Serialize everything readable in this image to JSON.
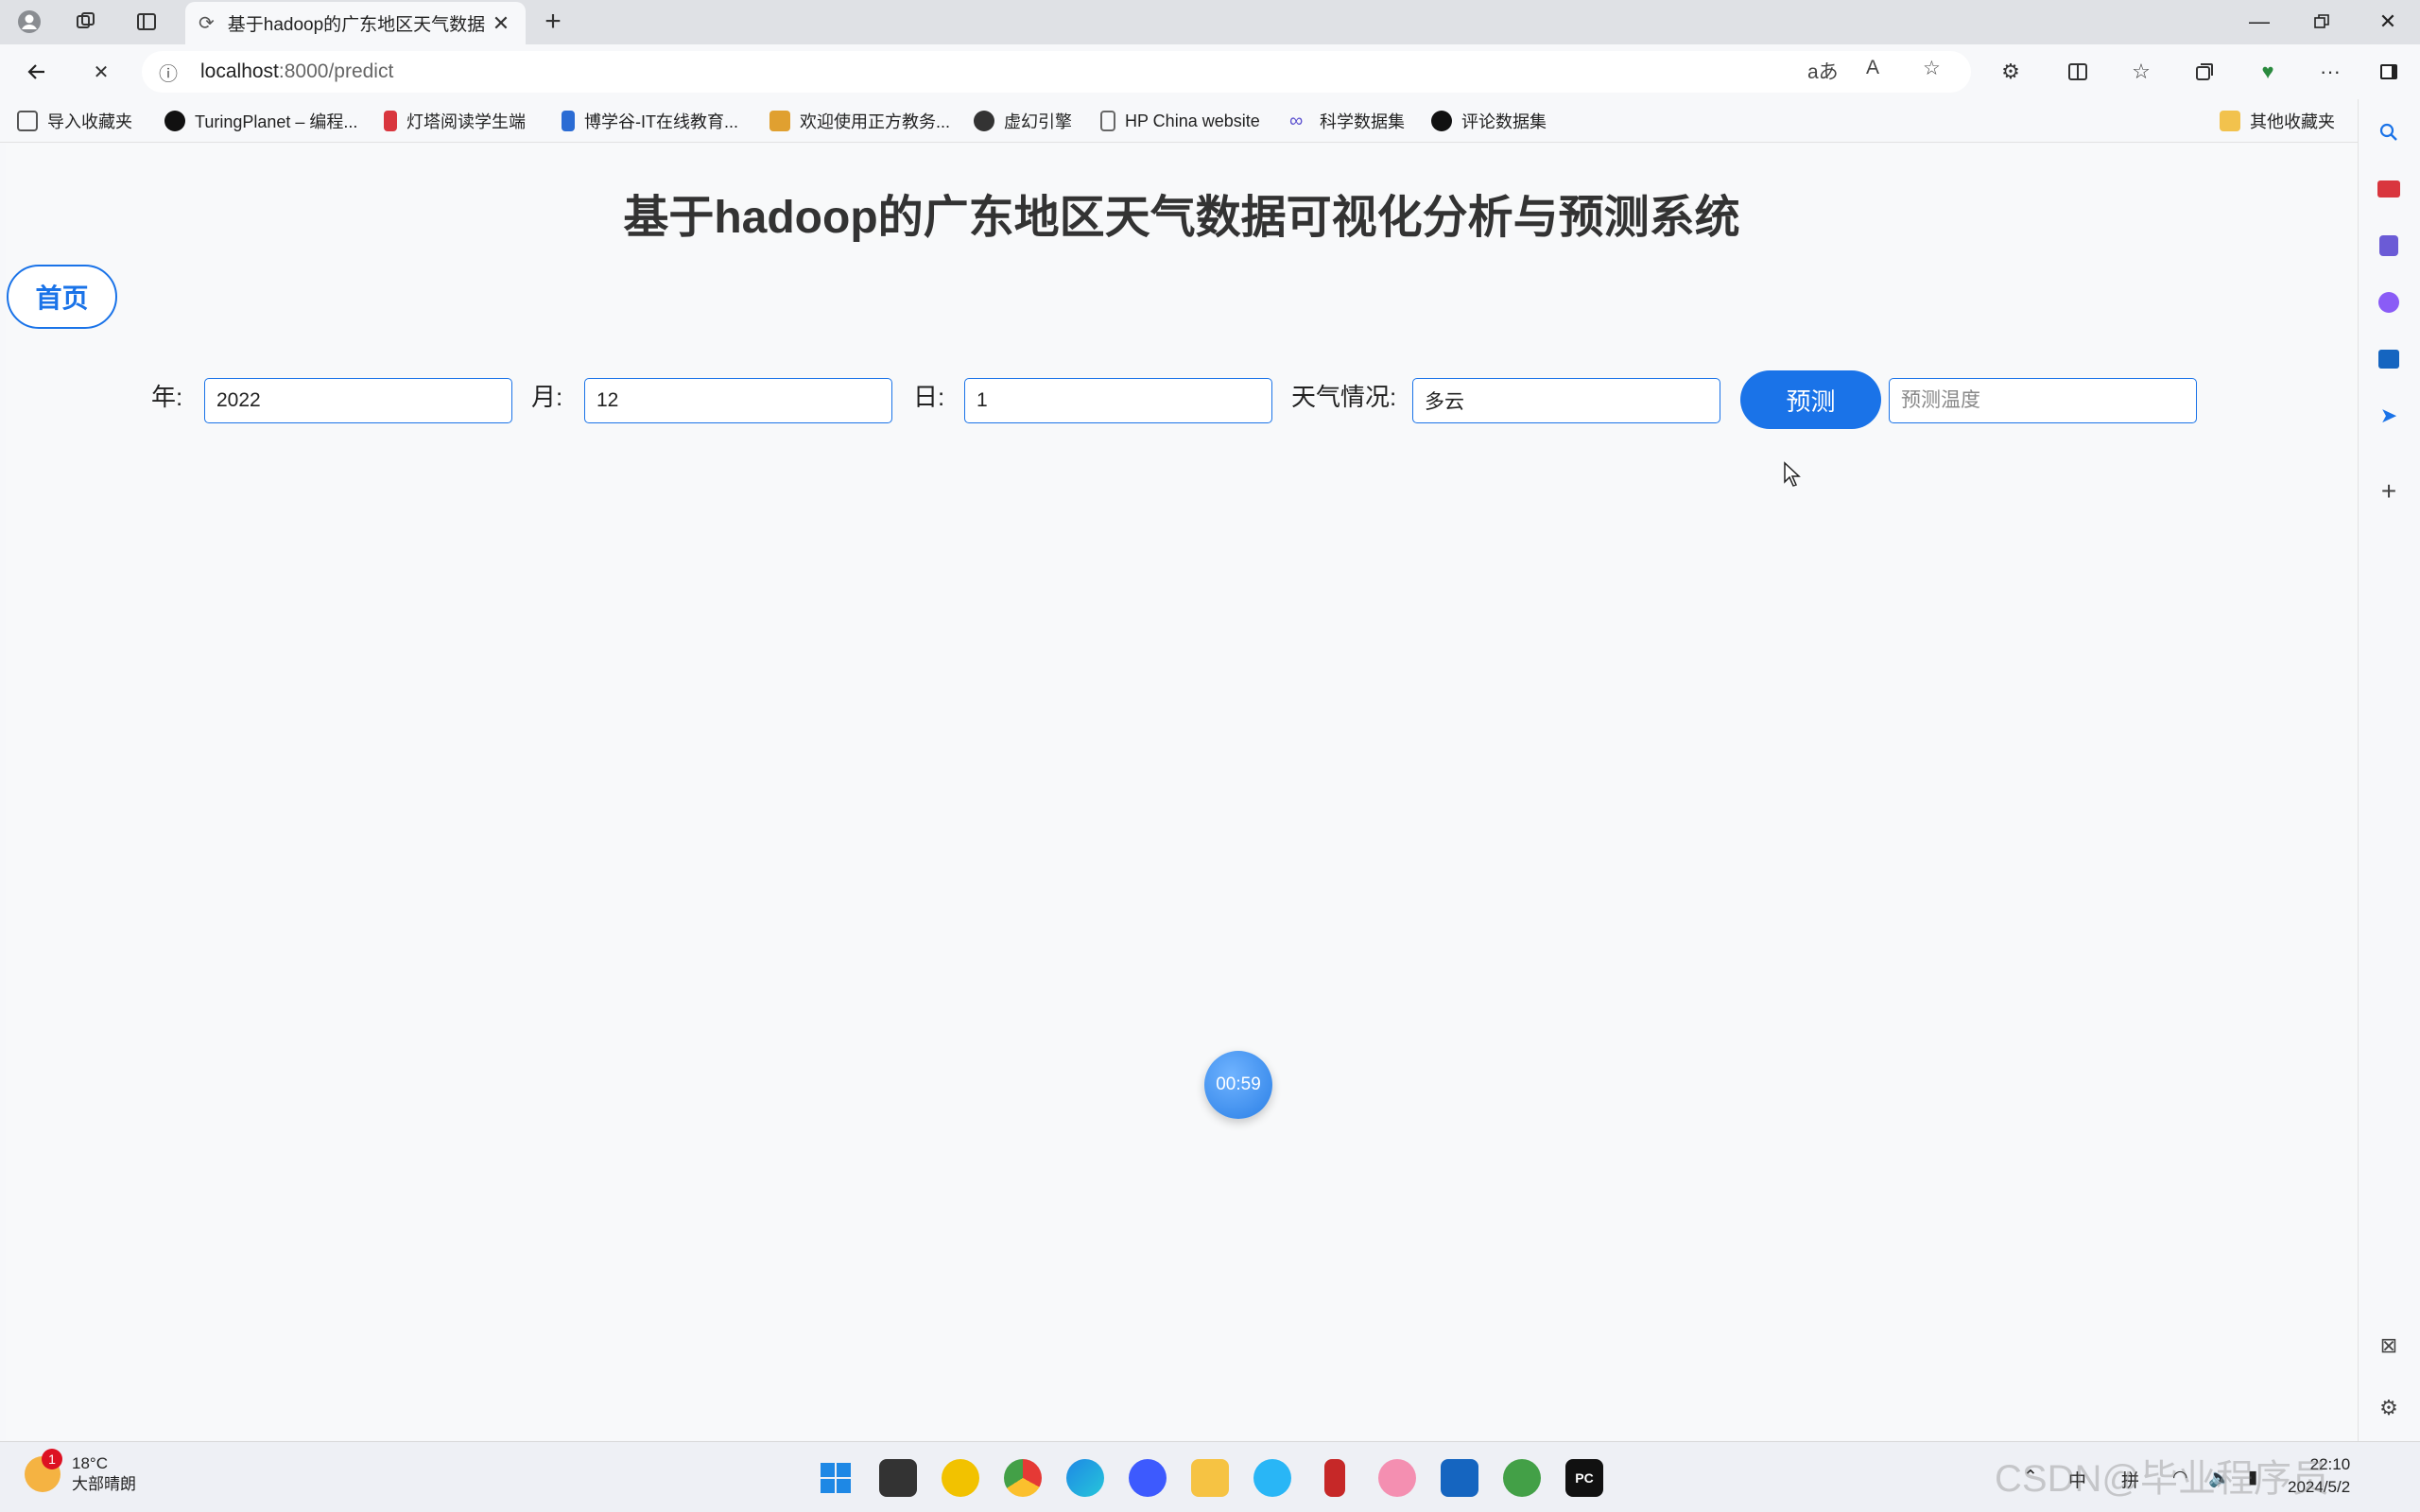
{
  "browser": {
    "tab_title": "基于hadoop的广东地区天气数据",
    "url_host": "localhost",
    "url_path": ":8000/predict"
  },
  "bookmarks": [
    {
      "label": "导入收藏夹",
      "color": "#555555"
    },
    {
      "label": "TuringPlanet – 编程...",
      "color": "#111111"
    },
    {
      "label": "灯塔阅读学生端",
      "color": "#d9363e"
    },
    {
      "label": "博学谷-IT在线教育...",
      "color": "#2b6cd4"
    },
    {
      "label": "欢迎使用正方教务...",
      "color": "#e0a030"
    },
    {
      "label": "虚幻引擎",
      "color": "#333333"
    },
    {
      "label": "HP China website",
      "color": "#666666"
    },
    {
      "label": "科学数据集",
      "color": "#5a4fcf"
    },
    {
      "label": "评论数据集",
      "color": "#111111"
    }
  ],
  "bookmarks_other": "其他收藏夹",
  "page": {
    "title": "基于hadoop的广东地区天气数据可视化分析与预测系统",
    "home_label": "首页",
    "year_label": "年:",
    "year_value": "2022",
    "month_label": "月:",
    "month_value": "12",
    "day_label": "日:",
    "day_value": "1",
    "weather_label": "天气情况:",
    "weather_value": "多云",
    "predict_label": "预测",
    "temp_placeholder": "预测温度",
    "timer": "00:59"
  },
  "taskbar": {
    "weather_temp": "18°C",
    "weather_desc": "大部晴朗",
    "weather_badge": "1",
    "ime_1": "中",
    "ime_2": "拼",
    "time": "22:10",
    "date": "2024/5/2"
  },
  "watermark": "CSDN@毕业程序员",
  "colors": {
    "accent": "#1a73e8"
  }
}
